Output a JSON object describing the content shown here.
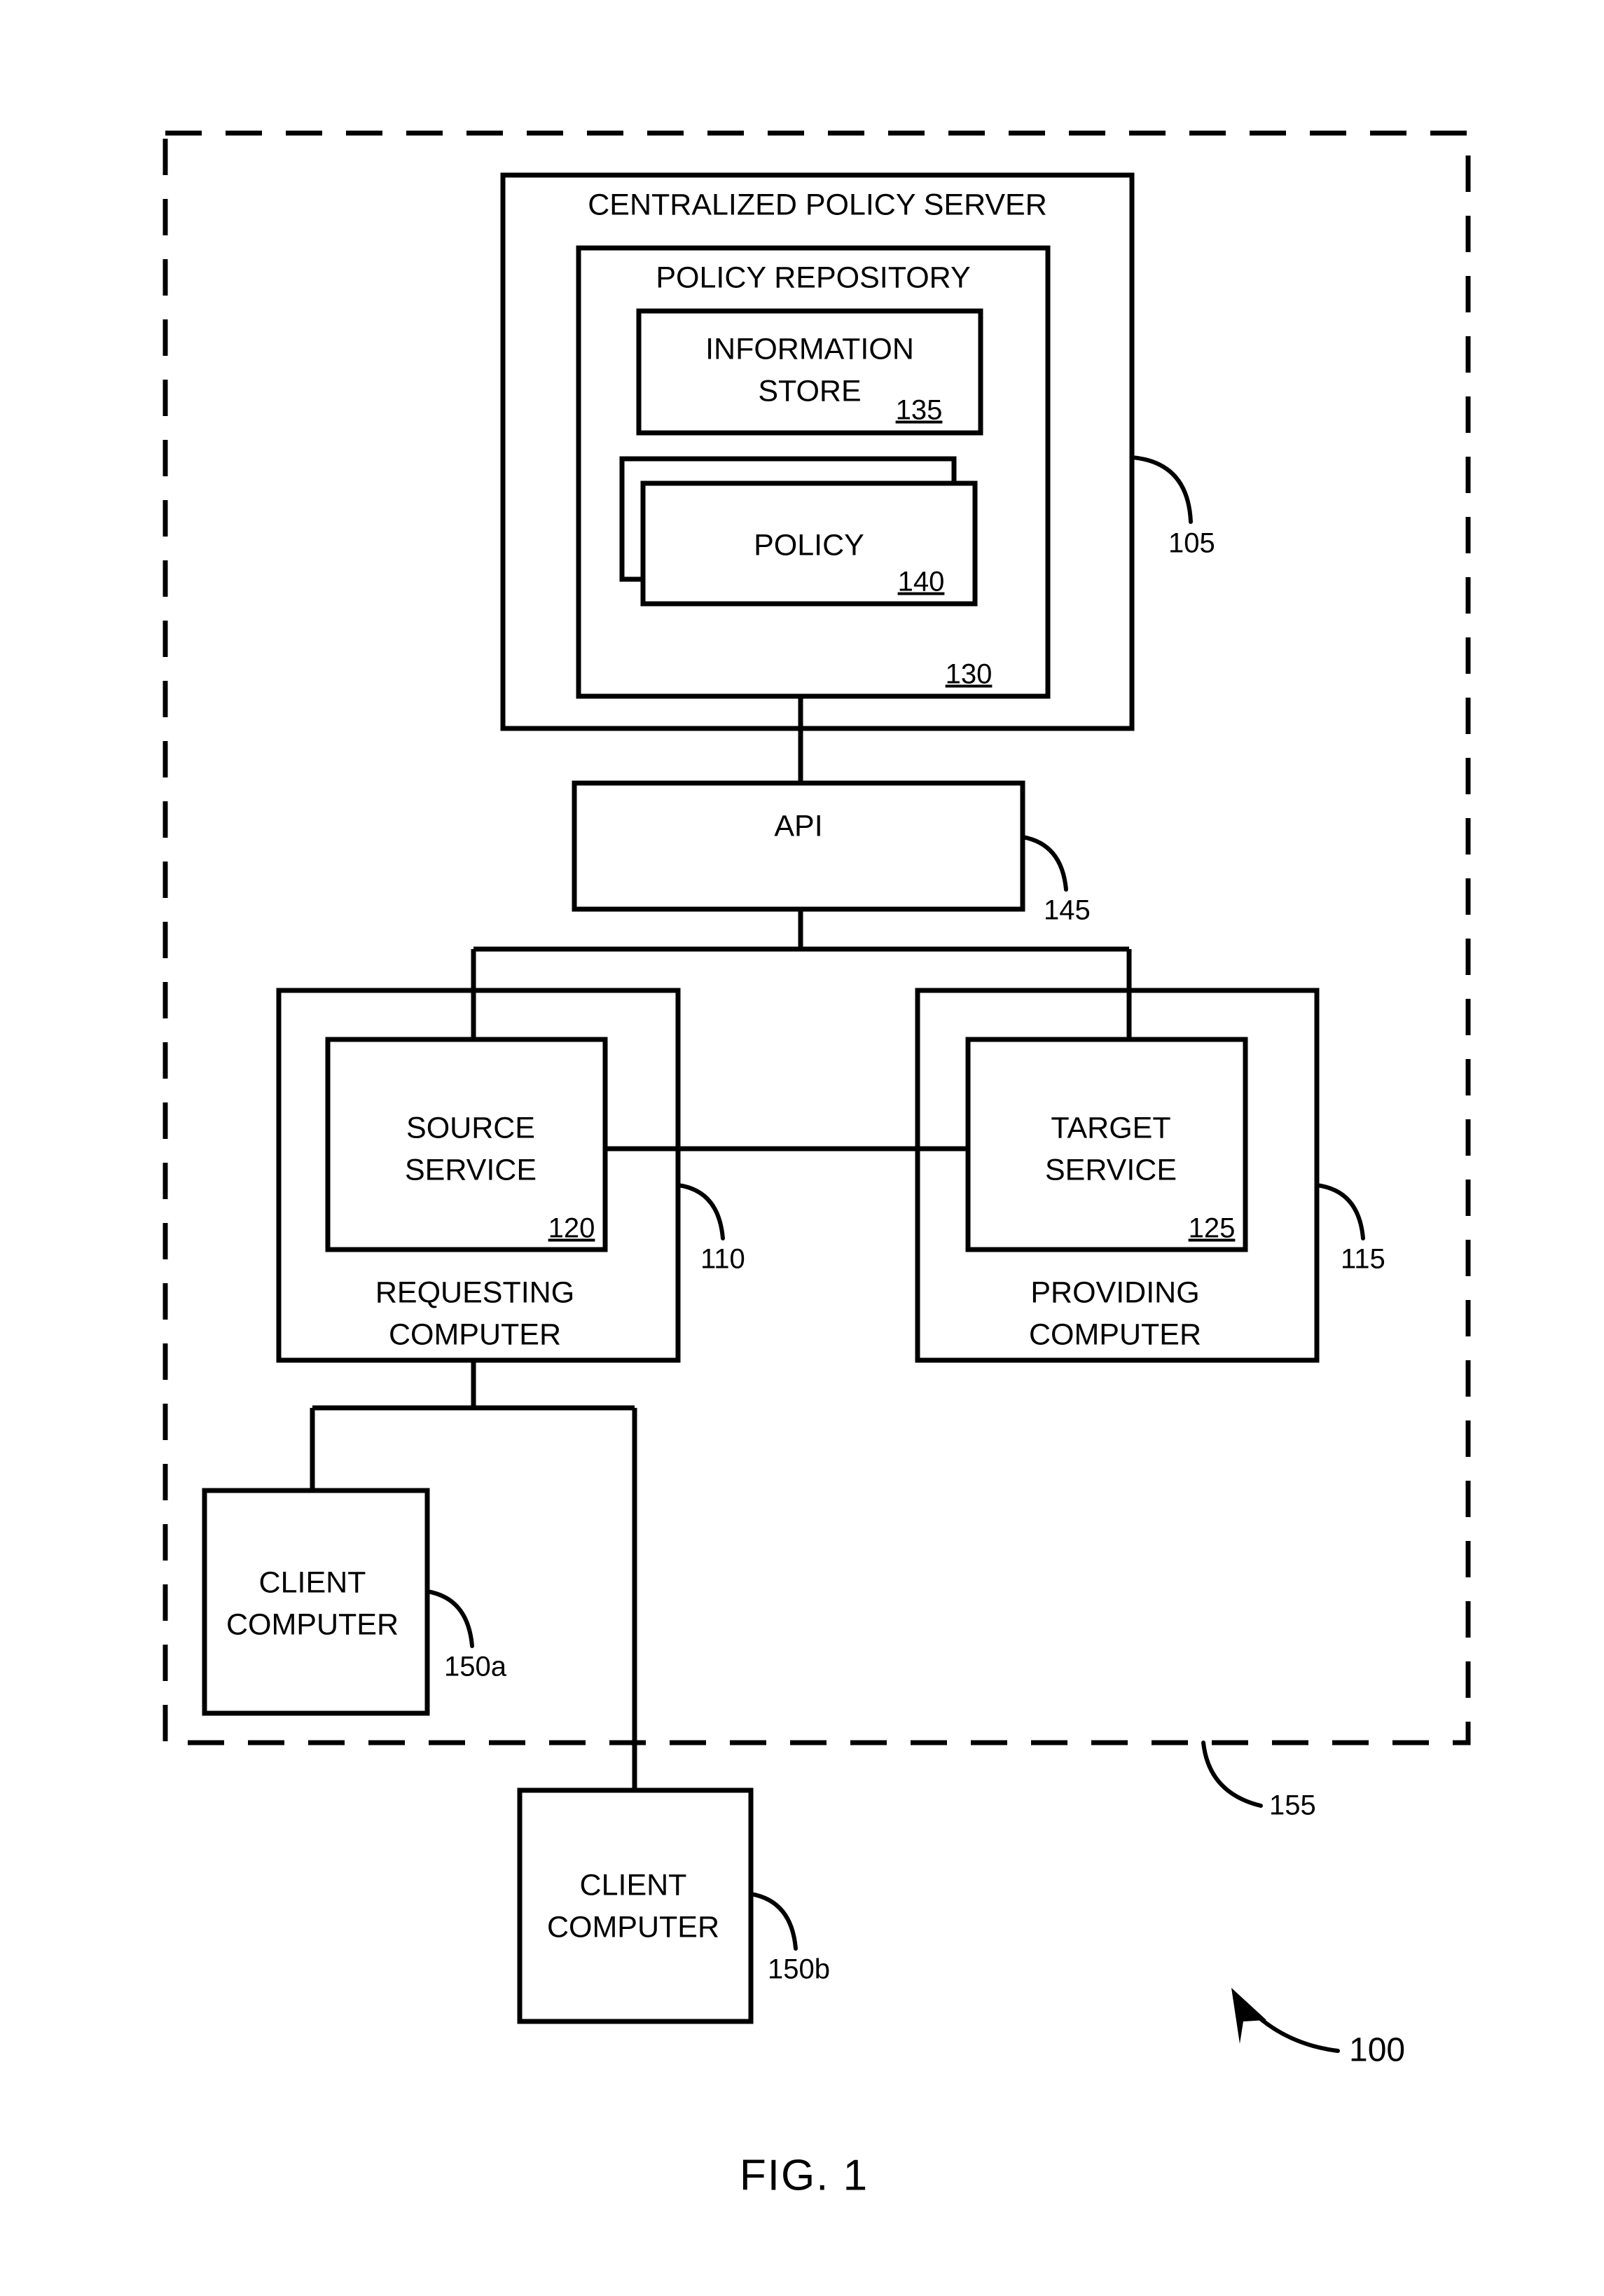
{
  "figure": {
    "caption": "FIG. 1",
    "system_ref": "100"
  },
  "boundary": {
    "name": "network-boundary",
    "ref": "155",
    "style": "dashed"
  },
  "blocks": {
    "centralized_policy_server": {
      "label": "CENTRALIZED POLICY SERVER",
      "ref": "105"
    },
    "policy_repository": {
      "label": "POLICY REPOSITORY",
      "ref": "130"
    },
    "information_store": {
      "label_line1": "INFORMATION",
      "label_line2": "STORE",
      "ref": "135"
    },
    "policy": {
      "label": "POLICY",
      "ref": "140",
      "stacked": true
    },
    "api": {
      "label": "API",
      "ref": "145"
    },
    "requesting_computer": {
      "label_line1": "REQUESTING",
      "label_line2": "COMPUTER",
      "ref": "110"
    },
    "source_service": {
      "label_line1": "SOURCE",
      "label_line2": "SERVICE",
      "ref": "120"
    },
    "providing_computer": {
      "label_line1": "PROVIDING",
      "label_line2": "COMPUTER",
      "ref": "115"
    },
    "target_service": {
      "label_line1": "TARGET",
      "label_line2": "SERVICE",
      "ref": "125"
    },
    "client_computer_a": {
      "label_line1": "CLIENT",
      "label_line2": "COMPUTER",
      "ref": "150a"
    },
    "client_computer_b": {
      "label_line1": "CLIENT",
      "label_line2": "COMPUTER",
      "ref": "150b"
    }
  },
  "colors": {
    "ink": "#000000",
    "paper": "#ffffff"
  }
}
